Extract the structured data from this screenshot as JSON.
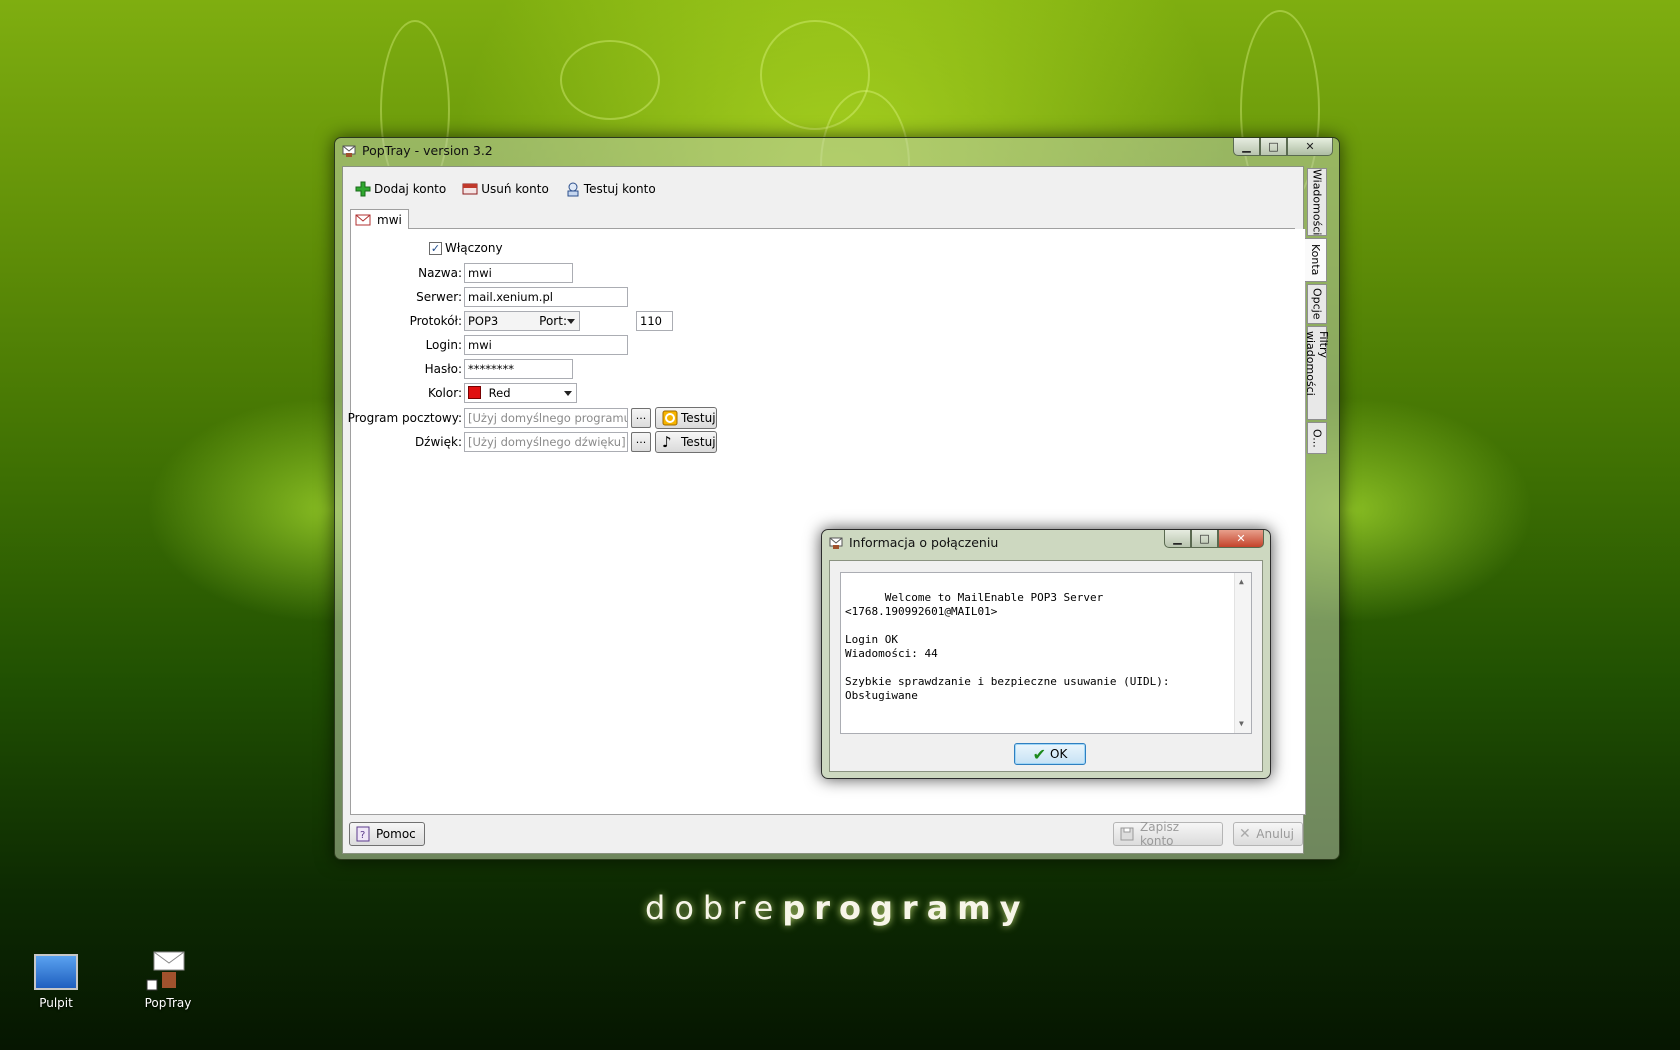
{
  "main_window": {
    "title": "PopTray - version 3.2",
    "toolbar": {
      "add": "Dodaj konto",
      "remove": "Usuń konto",
      "test": "Testuj konto"
    },
    "account_tab": "mwi",
    "form": {
      "enabled_label": "Włączony",
      "enabled_checked": true,
      "name_label": "Nazwa:",
      "name_value": "mwi",
      "server_label": "Serwer:",
      "server_value": "mail.xenium.pl",
      "protocol_label": "Protokół:",
      "protocol_value": "POP3",
      "port_label": "Port:",
      "port_value": "110",
      "login_label": "Login:",
      "login_value": "mwi",
      "password_label": "Hasło:",
      "password_value": "********",
      "color_label": "Kolor:",
      "color_value": "Red",
      "color_swatch": "#e01010",
      "mail_program_label": "Program pocztowy:",
      "mail_program_value": "[Użyj domyślnego programu]",
      "sound_label": "Dźwięk:",
      "sound_value": "[Użyj domyślnego dźwięku]",
      "browse_label": "...",
      "test_label": "Testuj"
    },
    "help_button": "Pomoc",
    "save_button": "Zapisz konto",
    "cancel_button": "Anuluj",
    "side_tabs": [
      "Wiadomości",
      "Konta",
      "Opcje",
      "Filtry wiadomości",
      "O..."
    ],
    "active_side_tab": "Konta"
  },
  "dialog": {
    "title": "Informacja o połączeniu",
    "message": "Welcome to MailEnable POP3 Server\n<1768.190992601@MAIL01>\n\nLogin OK\nWiadomości: 44\n\nSzybkie sprawdzanie i bezpieczne usuwanie (UIDL):\nObsługiwane",
    "ok_button": "OK"
  },
  "desktop": {
    "logo_light": "dobre",
    "logo_bold": "programy",
    "icons": [
      "Pulpit",
      "PopTray"
    ]
  }
}
